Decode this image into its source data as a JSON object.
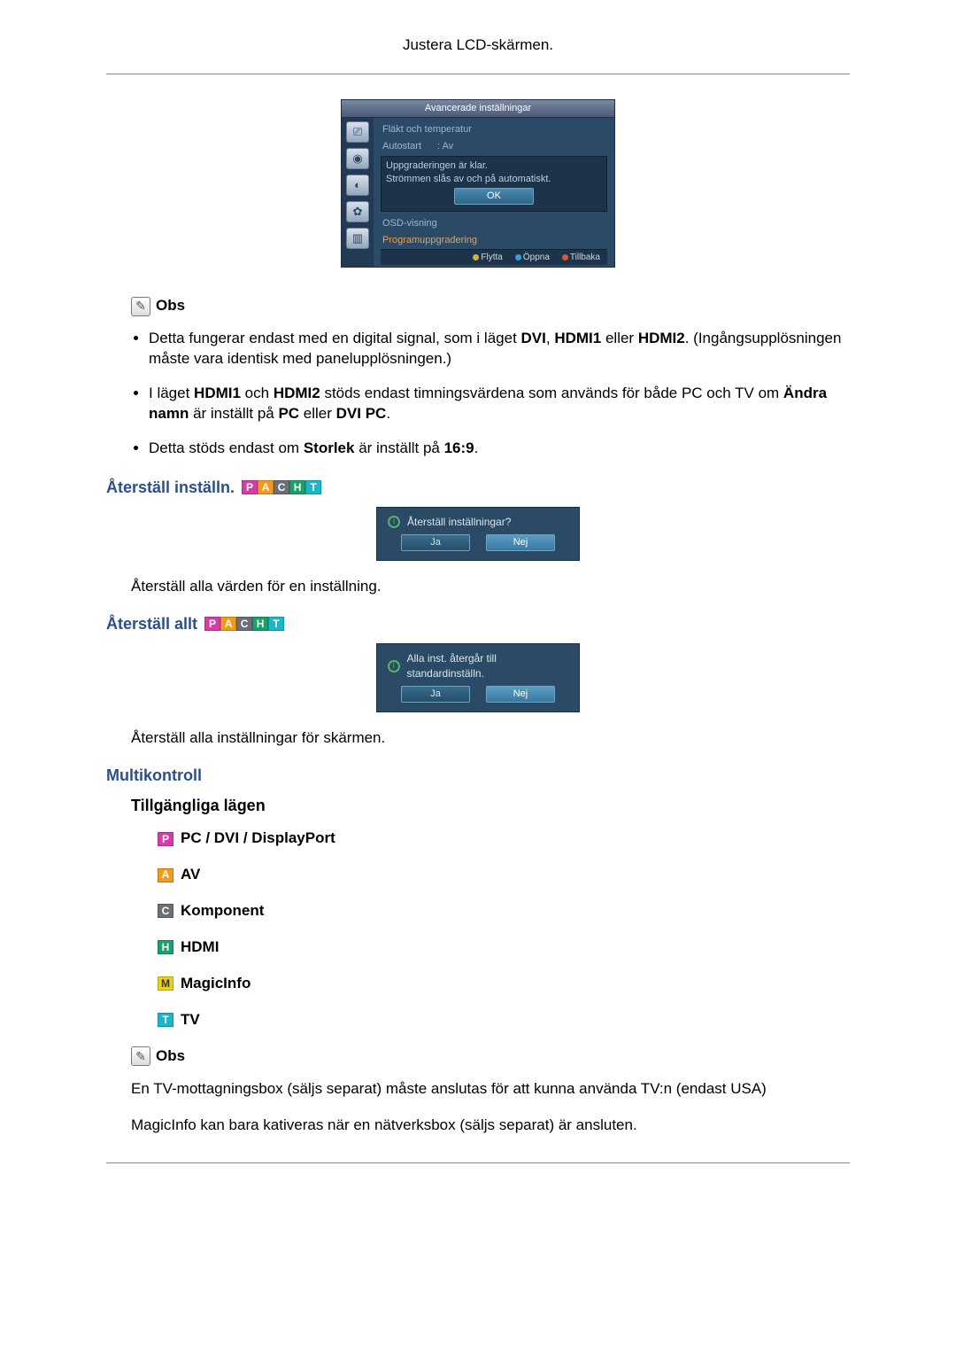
{
  "header": {
    "title": "Justera LCD-skärmen."
  },
  "osd": {
    "title": "Avancerade inställningar",
    "items": {
      "fan": "Fläkt och temperatur",
      "autostart_label": "Autostart",
      "autostart_value": ": Av",
      "upgrade_done": "Uppgraderingen är klar.",
      "restart_msg": "Strömmen slås av och på automatiskt.",
      "ok": "OK",
      "osd_view": "OSD-visning",
      "prog_upgrade": "Programuppgradering"
    },
    "hints": {
      "move": "Flytta",
      "open": "Öppna",
      "back": "Tillbaka"
    }
  },
  "obs_label": "Obs",
  "list1": {
    "i1a": "Detta fungerar endast med en digital signal, som i läget ",
    "i1b": "DVI",
    "i1c": ", ",
    "i1d": "HDMI1",
    "i1e": " eller ",
    "i1f": "HDMI2",
    "i1g": ". (Ingångsupplösningen måste vara identisk med panelupplösningen.)",
    "i2a": "I läget ",
    "i2b": "HDMI1",
    "i2c": " och ",
    "i2d": "HDMI2",
    "i2e": " stöds endast timningsvärdena som används för både PC och TV om ",
    "i2f": "Ändra namn",
    "i2g": " är inställt på ",
    "i2h": "PC",
    "i2i": " eller ",
    "i2j": "DVI PC",
    "i2k": ".",
    "i3a": "Detta stöds endast om ",
    "i3b": "Storlek",
    "i3c": " är inställt på ",
    "i3d": "16:9",
    "i3e": "."
  },
  "reset_settings": {
    "heading": "Återställ inställn.",
    "question": "Återställ inställningar?",
    "yes": "Ja",
    "no": "Nej",
    "desc": "Återställ alla värden för en inställning."
  },
  "reset_all": {
    "heading": "Återställ allt",
    "question": "Alla inst. återgår till standardinställn.",
    "yes": "Ja",
    "no": "Nej",
    "desc": "Återställ alla inställningar för skärmen."
  },
  "multi": {
    "heading": "Multikontroll",
    "sub": "Tillgängliga lägen",
    "modes": {
      "pc": "PC / DVI / DisplayPort",
      "av": "AV",
      "component": "Komponent",
      "hdmi": "HDMI",
      "magicinfo": "MagicInfo",
      "tv": "TV"
    },
    "note1": "En TV-mottagningsbox (säljs separat) måste anslutas för att kunna använda TV:n (endast USA)",
    "note2": "MagicInfo kan bara kativeras när en nätverksbox (säljs separat) är ansluten."
  }
}
